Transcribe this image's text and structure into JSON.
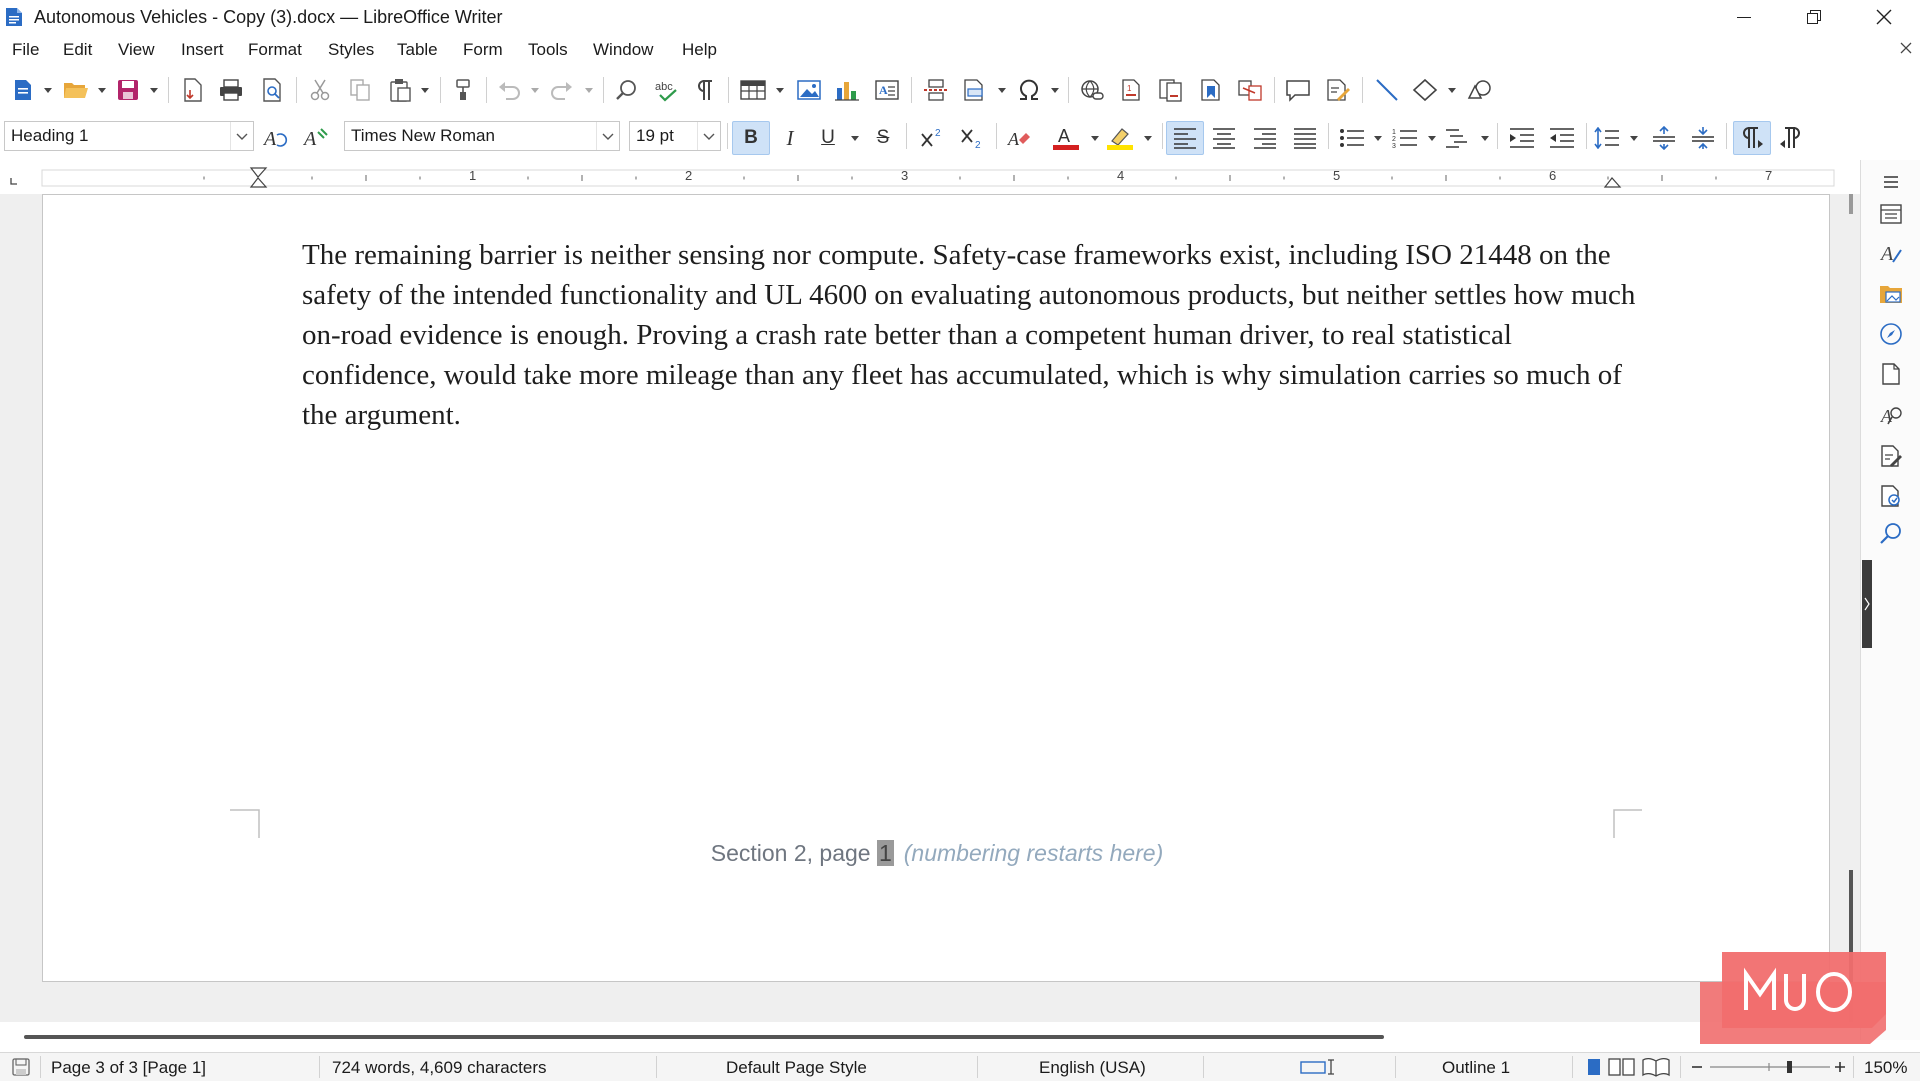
{
  "window": {
    "title": "Autonomous Vehicles - Copy (3).docx — LibreOffice Writer"
  },
  "menu": [
    "File",
    "Edit",
    "View",
    "Insert",
    "Format",
    "Styles",
    "Table",
    "Form",
    "Tools",
    "Window",
    "Help"
  ],
  "formatting": {
    "paragraph_style": "Heading 1",
    "font_name": "Times New Roman",
    "font_size": "19 pt",
    "bold_label": "B",
    "italic_label": "I",
    "underline_label": "U",
    "strike_label": "S"
  },
  "ruler": {
    "numbers": [
      "1",
      "2",
      "3",
      "4",
      "5",
      "6",
      "7"
    ]
  },
  "document": {
    "body_paragraph": "The remaining barrier is neither sensing nor compute. Safety-case frameworks exist, including ISO 21448 on the safety of the intended functionality and UL 4600 on evaluating autonomous products, but neither settles how much on-road evidence is enough. Proving a crash rate better than a competent human driver, to real statistical confidence, would take more mileage than any fleet has accumulated, which is why simulation carries so much of the argument.",
    "footer_prefix": "Section 2, page ",
    "footer_page_number": "1",
    "footer_note": "(numbering restarts here)"
  },
  "statusbar": {
    "page": "Page 3 of 3 [Page 1]",
    "word_count": "724 words, 4,609 characters",
    "page_style": "Default Page Style",
    "language": "English (USA)",
    "outline": "Outline 1",
    "zoom": "150%"
  },
  "watermark": {
    "text": "MUO"
  },
  "colors": {
    "accent": "#2b6cc4",
    "font_color": "#d42020",
    "highlight": "#ffe300",
    "watermark_bg": "#f16e6e"
  }
}
